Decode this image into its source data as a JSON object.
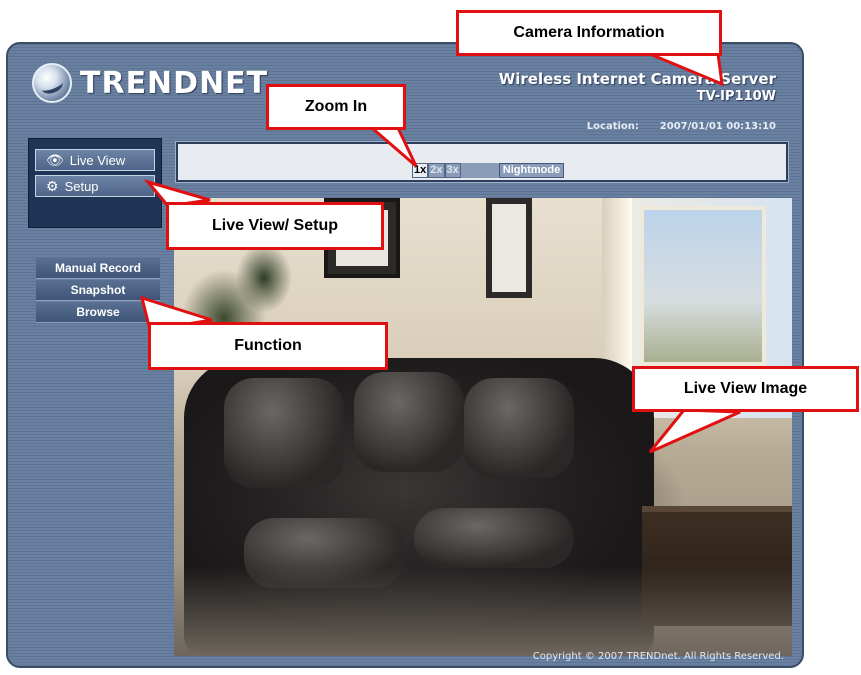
{
  "brand": {
    "logo_text": "TRENDNET"
  },
  "camera": {
    "title": "Wireless Internet Camera Server",
    "model": "TV-IP110W",
    "location_label": "Location:",
    "datetime": "2007/01/01 00:13:10"
  },
  "nav": {
    "live_view_label": "Live View",
    "setup_label": "Setup",
    "live_view_icon": "eye-icon",
    "setup_icon": "gears-icon"
  },
  "functions": [
    "Manual Record",
    "Snapshot",
    "Browse"
  ],
  "zoom": {
    "levels": [
      "1x",
      "2x",
      "3x"
    ],
    "selected": "1x",
    "nightmode_label": "Nightmode"
  },
  "footer": {
    "copyright": "Copyright © 2007 TRENDnet. All Rights Reserved."
  },
  "callouts": {
    "camera_information": "Camera Information",
    "zoom_in": "Zoom In",
    "live_view_setup": "Live View/ Setup",
    "function": "Function",
    "live_view_image": "Live View Image"
  },
  "colors": {
    "callout_border": "#e01010",
    "panel": "#6a80a0",
    "nav_dark": "#1f3556"
  }
}
